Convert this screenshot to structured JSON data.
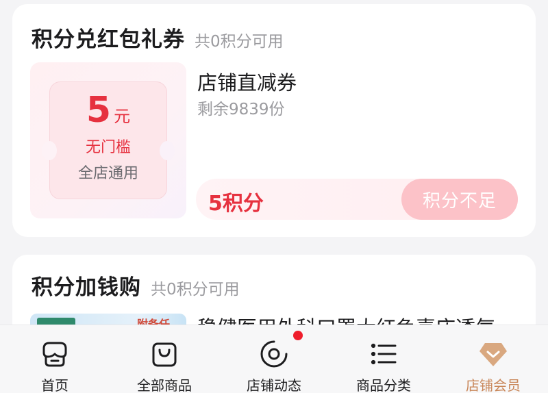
{
  "redeem_section": {
    "title": "积分兑红包礼券",
    "subtitle": "共0积分可用",
    "coupon": {
      "amount": "5",
      "unit": "元",
      "threshold": "无门槛",
      "scope": "全店通用",
      "name": "店铺直减券",
      "remaining": "剩余9839份",
      "points_price": "5积分",
      "button_label": "积分不足"
    }
  },
  "points_plus_cash_section": {
    "title": "积分加钱购",
    "subtitle": "共0积分可用",
    "product": {
      "thumb_label": "附备任",
      "title": "稳健医用外科口罩大红色喜庆透气"
    }
  },
  "tabbar": {
    "tabs": [
      {
        "label": "首页",
        "icon": "storefront-icon"
      },
      {
        "label": "全部商品",
        "icon": "shopping-bag-icon"
      },
      {
        "label": "店铺动态",
        "icon": "dynamic-circle-icon",
        "has_notification_dot": true
      },
      {
        "label": "商品分类",
        "icon": "list-icon"
      },
      {
        "label": "店铺会员",
        "icon": "member-diamond-icon",
        "active": true
      }
    ]
  },
  "colors": {
    "accent_red": "#e6313f",
    "active_tab": "#c9875a",
    "disabled_button": "#fcc2c8"
  }
}
